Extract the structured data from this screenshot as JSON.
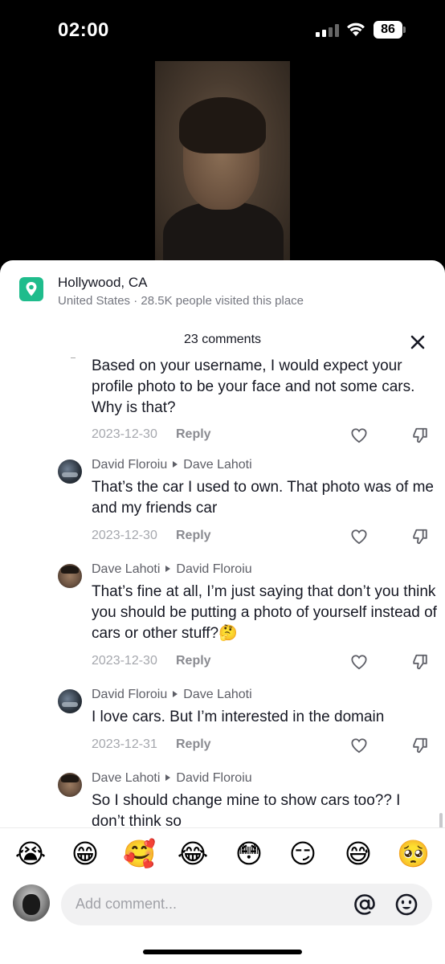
{
  "status_bar": {
    "time": "02:00",
    "battery": "86",
    "icons": [
      "signal-icon",
      "wifi-icon",
      "battery-icon"
    ]
  },
  "location": {
    "name": "Hollywood, CA",
    "subtitle": "United States · 28.5K people visited this place",
    "icon": "location-pin-icon",
    "accent_color": "#1fbc8c"
  },
  "comments_header": {
    "count_label": "23 comments",
    "close_icon": "close-icon"
  },
  "comments": [
    {
      "author": "",
      "reply_to": "",
      "text": "Based on your username, I would expect your profile photo to be your face and not some cars. Why is that?",
      "date": "2023-12-30",
      "reply_label": "Reply"
    },
    {
      "author": "David Floroiu",
      "reply_to": "Dave Lahoti",
      "text": "That’s the car I used to own. That photo was of me and my friends car",
      "date": "2023-12-30",
      "reply_label": "Reply"
    },
    {
      "author": "Dave Lahoti",
      "reply_to": "David Floroiu",
      "text": "That’s fine at all, I’m just saying that don’t you think you should be putting a photo of yourself instead of cars or other stuff?🤔",
      "date": "2023-12-30",
      "reply_label": "Reply"
    },
    {
      "author": "David Floroiu",
      "reply_to": "Dave Lahoti",
      "text": "I love cars. But I’m interested in the domain",
      "date": "2023-12-31",
      "reply_label": "Reply"
    },
    {
      "author": "Dave Lahoti",
      "reply_to": "David Floroiu",
      "text": "So I should change mine to show cars too?? I don’t think so",
      "date": "",
      "reply_label": ""
    }
  ],
  "emoji_bar": [
    "😭",
    "😁",
    "🥰",
    "😂",
    "😳",
    "😏",
    "😅",
    "🥺"
  ],
  "comment_input": {
    "placeholder": "Add comment...",
    "at_icon": "at-icon",
    "emoji_icon": "smile-icon"
  }
}
